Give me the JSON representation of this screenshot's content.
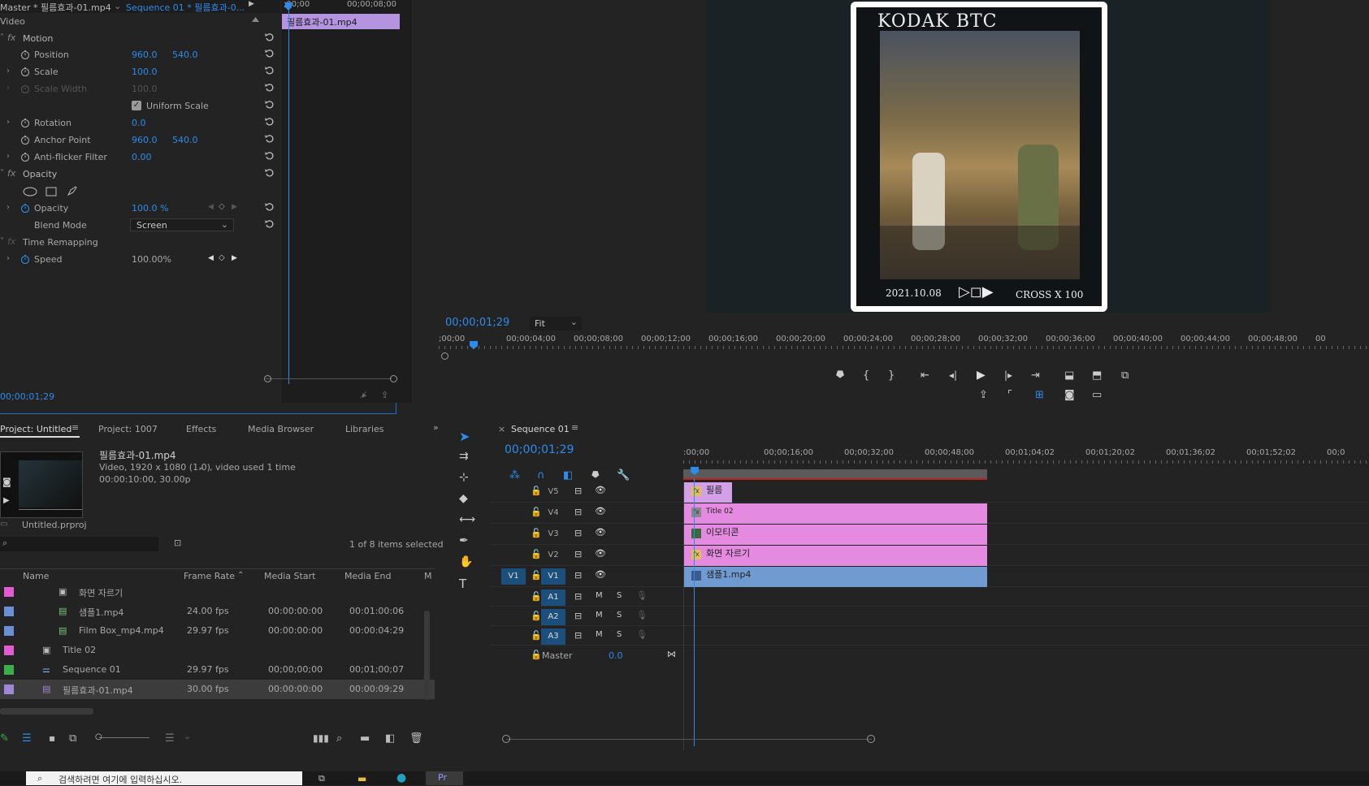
{
  "effect_controls": {
    "master_tab": "Master * 필름효과-01.mp4",
    "sequence_tab": "Sequence 01 * 필름효과-0...",
    "section": "Video",
    "clip_label": "필름효과-01.mp4",
    "ruler_start": ";00;00",
    "ruler_end": "00;00;08;00",
    "timecode": "00;00;01;29",
    "motion": {
      "title": "Motion",
      "position_label": "Position",
      "position_x": "960.0",
      "position_y": "540.0",
      "scale_label": "Scale",
      "scale": "100.0",
      "scale_width_label": "Scale Width",
      "scale_width": "100.0",
      "uniform_scale_label": "Uniform Scale",
      "rotation_label": "Rotation",
      "rotation": "0.0",
      "anchor_label": "Anchor Point",
      "anchor_x": "960.0",
      "anchor_y": "540.0",
      "antiflicker_label": "Anti-flicker Filter",
      "antiflicker": "0.00"
    },
    "opacity": {
      "title": "Opacity",
      "opacity_label": "Opacity",
      "opacity": "100.0 %",
      "blend_label": "Blend Mode",
      "blend": "Screen"
    },
    "time_remap": {
      "title": "Time Remapping",
      "speed_label": "Speed",
      "speed": "100.00%"
    }
  },
  "program": {
    "timecode": "00;00;01;29",
    "zoom": "Fit",
    "ruler": [
      ";00;00",
      "00;00;04;00",
      "00;00;08;00",
      "00;00;12;00",
      "00;00;16;00",
      "00;00;20;00",
      "00;00;24;00",
      "00;00;28;00",
      "00;00;32;00",
      "00;00;36;00",
      "00;00;40;00",
      "00;00;44;00",
      "00;00;48;00",
      "00"
    ],
    "frame_title": "KODAK BTC",
    "frame_date": "2021.10.08",
    "frame_cross": "CROSS X 100"
  },
  "project": {
    "tabs": [
      "Project: Untitled",
      "Project: 1007",
      "Effects",
      "Media Browser",
      "Libraries"
    ],
    "preview_name": "필름효과-01.mp4",
    "preview_info1": "Video, 1920 x 1080 (1.0)",
    "preview_info1b": ", video used 1 time",
    "preview_info2": "00:00:10:00, 30.00p",
    "project_file": "Untitled.prproj",
    "selection": "1 of 8 items selected",
    "columns": [
      "Name",
      "Frame Rate",
      "Media Start",
      "Media End",
      "M"
    ],
    "items": [
      {
        "name": "화면 자르기",
        "rate": "",
        "start": "",
        "end": "",
        "color": "#e45ad2"
      },
      {
        "name": "샘플1.mp4",
        "rate": "24.00 fps",
        "start": "00:00:00:00",
        "end": "00:01:00:06",
        "color": "#6b8fd6"
      },
      {
        "name": "Film Box_mp4.mp4",
        "rate": "29.97 fps",
        "start": "00:00:00:00",
        "end": "00:00:04:29",
        "color": "#6b8fd6"
      },
      {
        "name": "Title 02",
        "rate": "",
        "start": "",
        "end": "",
        "color": "#e45ad2"
      },
      {
        "name": "Sequence 01",
        "rate": "29.97 fps",
        "start": "00;00;00;00",
        "end": "00;01;00;07",
        "color": "#3bb04a"
      },
      {
        "name": "필름효과-01.mp4",
        "rate": "30.00 fps",
        "start": "00:00:00:00",
        "end": "00:00:09:29",
        "color": "#9f87d8"
      }
    ]
  },
  "timeline": {
    "tab": "Sequence 01",
    "timecode": "00;00;01;29",
    "ruler": [
      ":00;00",
      "00;00;16;00",
      "00;00;32;00",
      "00;00;48;00",
      "00;01;04;02",
      "00;01;20;02",
      "00;01;36;02",
      "00;01;52;02",
      "00;0"
    ],
    "tracks": [
      {
        "id": "V5",
        "type": "video"
      },
      {
        "id": "V4",
        "type": "video"
      },
      {
        "id": "V3",
        "type": "video"
      },
      {
        "id": "V2",
        "type": "video"
      },
      {
        "id": "V1",
        "type": "video",
        "src": "V1"
      },
      {
        "id": "A1",
        "type": "audio"
      },
      {
        "id": "A2",
        "type": "audio"
      },
      {
        "id": "A3",
        "type": "audio"
      }
    ],
    "clips": {
      "v5": "필름",
      "v4": "Title 02",
      "v3": "이모티콘",
      "v2": "화면 자르기",
      "v1": "샘플1.mp4"
    },
    "master_label": "Master",
    "master_value": "0.0",
    "m_label": "M",
    "s_label": "S"
  },
  "taskbar": {
    "search_placeholder": "검색하려면 여기에 입력하십시오."
  }
}
